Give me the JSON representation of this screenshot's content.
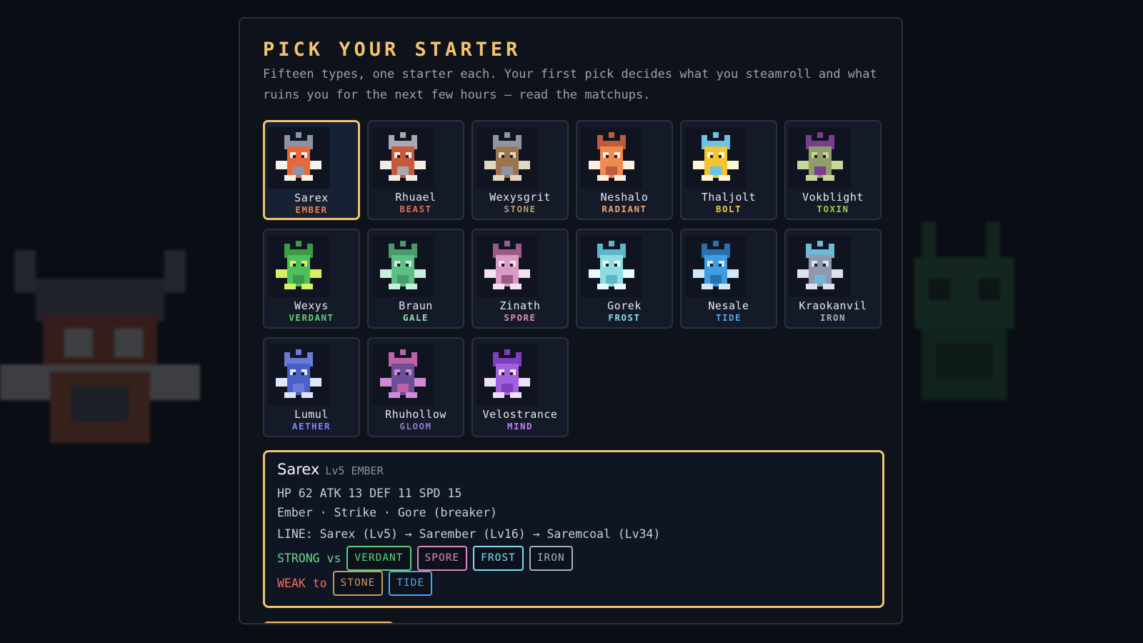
{
  "title": "PICK YOUR STARTER",
  "subtitle": "Fifteen types, one starter each. Your first pick decides what you steamroll and what ruins you for the next few hours — read the matchups.",
  "colors": {
    "accent": "#f2c46d",
    "strong_label": "#6bd68f",
    "weak_label": "#ef6f5e"
  },
  "starters": [
    {
      "name": "Sarex",
      "type": "EMBER",
      "type_color": "#e8834e",
      "body": "#e8683c",
      "accent": "#f6f2e8",
      "horn": "#8a94a6",
      "selected": true
    },
    {
      "name": "Rhuael",
      "type": "BEAST",
      "type_color": "#d9734f",
      "body": "#c85a3c",
      "accent": "#f3ece2",
      "horn": "#a8a8b0",
      "selected": false
    },
    {
      "name": "Wexysgrit",
      "type": "STONE",
      "type_color": "#b89a6e",
      "body": "#9c7450",
      "accent": "#e3d6c0",
      "horn": "#8e96a4",
      "selected": false
    },
    {
      "name": "Neshalo",
      "type": "RADIANT",
      "type_color": "#f5a26b",
      "body": "#ef8a50",
      "accent": "#fbf0e0",
      "horn": "#c05a3c",
      "selected": false
    },
    {
      "name": "Thaljolt",
      "type": "BOLT",
      "type_color": "#f2c94c",
      "body": "#f2c431",
      "accent": "#fff6d8",
      "horn": "#6cc3e8",
      "selected": false
    },
    {
      "name": "Vokblight",
      "type": "TOXIN",
      "type_color": "#9ccb4a",
      "body": "#8f9e6a",
      "accent": "#c8d69a",
      "horn": "#7a3e90",
      "selected": false
    },
    {
      "name": "Wexys",
      "type": "VERDANT",
      "type_color": "#5fcf7a",
      "body": "#4fbf5e",
      "accent": "#d8f060",
      "horn": "#3b9a45",
      "selected": false
    },
    {
      "name": "Braun",
      "type": "GALE",
      "type_color": "#8ee0b0",
      "body": "#5ebf86",
      "accent": "#c8f0d8",
      "horn": "#4a9a6c",
      "selected": false
    },
    {
      "name": "Zinath",
      "type": "SPORE",
      "type_color": "#e08ab8",
      "body": "#d99ac6",
      "accent": "#f6e0ec",
      "horn": "#9c5a86",
      "selected": false
    },
    {
      "name": "Gorek",
      "type": "FROST",
      "type_color": "#7ee0f0",
      "body": "#8fdde0",
      "accent": "#e8fbfb",
      "horn": "#5ab8c8",
      "selected": false
    },
    {
      "name": "Nesale",
      "type": "TIDE",
      "type_color": "#4aa8f0",
      "body": "#3f9de0",
      "accent": "#cfe9fb",
      "horn": "#2a70b0",
      "selected": false
    },
    {
      "name": "Kraokanvil",
      "type": "IRON",
      "type_color": "#a8b0c0",
      "body": "#8e98b0",
      "accent": "#dce2ec",
      "horn": "#6fb8d8",
      "selected": false
    },
    {
      "name": "Lumul",
      "type": "AETHER",
      "type_color": "#7a8cf0",
      "body": "#4a5fc8",
      "accent": "#e0e6fb",
      "horn": "#6a7ad8",
      "selected": false
    },
    {
      "name": "Rhuhollow",
      "type": "GLOOM",
      "type_color": "#8a7cc8",
      "body": "#6a5098",
      "accent": "#d08ad8",
      "horn": "#c060a8",
      "selected": false
    },
    {
      "name": "Velostrance",
      "type": "MIND",
      "type_color": "#c77cf0",
      "body": "#a060e0",
      "accent": "#f0e0fb",
      "horn": "#7e3ec0",
      "selected": false
    }
  ],
  "detail": {
    "name": "Sarex",
    "sub": "Lv5 EMBER",
    "stats": "HP 62 ATK 13 DEF 11 SPD 15",
    "moves": "Ember · Strike · Gore (breaker)",
    "evolution": "LINE: Sarex (Lv5) → Sarember (Lv16) → Saremcoal (Lv34)",
    "strong_label": "STRONG vs",
    "weak_label": "WEAK to",
    "strong": [
      {
        "label": "VERDANT",
        "color": "#5fcf7a"
      },
      {
        "label": "SPORE",
        "color": "#e08ab8"
      },
      {
        "label": "FROST",
        "color": "#7ee0f0"
      },
      {
        "label": "IRON",
        "color": "#a8b0c0"
      }
    ],
    "weak": [
      {
        "label": "STONE",
        "color": "#c89a5e"
      },
      {
        "label": "TIDE",
        "color": "#4aa8f0"
      }
    ]
  }
}
